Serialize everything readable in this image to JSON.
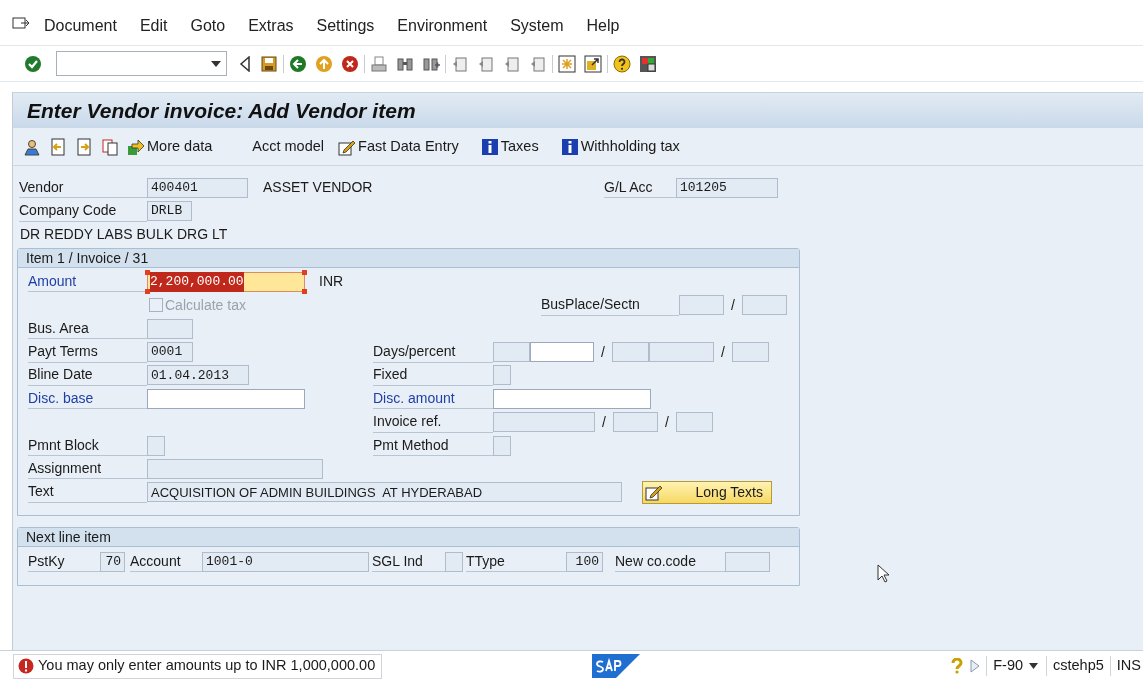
{
  "menu": [
    "Document",
    "Edit",
    "Goto",
    "Extras",
    "Settings",
    "Environment",
    "System",
    "Help"
  ],
  "title": "Enter Vendor invoice: Add Vendor item",
  "app_toolbar": [
    {
      "kind": "person"
    },
    {
      "kind": "doc-back"
    },
    {
      "kind": "doc-forward"
    },
    {
      "kind": "copy"
    },
    {
      "kind": "arrow",
      "label": "More data"
    },
    {
      "kind": "text",
      "label": "Acct model"
    },
    {
      "kind": "pencil",
      "label": "Fast Data Entry"
    },
    {
      "kind": "info",
      "label": "Taxes"
    },
    {
      "kind": "info",
      "label": "Withholding tax"
    }
  ],
  "header": {
    "vendor": {
      "label": "Vendor",
      "value": "400401",
      "description": "ASSET VENDOR"
    },
    "gl_account": {
      "label": "G/L Acc",
      "value": "101205"
    },
    "company_code": {
      "label": "Company Code",
      "value": "DRLB"
    },
    "company_name": "DR REDDY LABS BULK DRG LT"
  },
  "item": {
    "title": "Item 1 / Invoice / 31",
    "amount": {
      "label": "Amount",
      "highlighted": true,
      "value": "2,200,000.00",
      "error": true,
      "currency": "INR"
    },
    "calculate_tax": {
      "label": "Calculate tax",
      "checked": false,
      "disabled": true
    },
    "bus_place": {
      "label": "BusPlace/Sectn",
      "highlighted": false,
      "boxes": [
        {
          "editable": false
        },
        {
          "editable": false,
          "prefix": "/"
        }
      ]
    },
    "bus_area": {
      "label": "Bus. Area",
      "highlighted": false,
      "boxes": [
        {
          "editable": false
        }
      ]
    },
    "payt_terms": {
      "label": "Payt Terms",
      "highlighted": false,
      "boxes": [
        {
          "editable": false,
          "value": "0001"
        }
      ]
    },
    "days_percent": {
      "label": "Days/percent",
      "highlighted": false,
      "boxes": [
        {
          "editable": false
        },
        {
          "editable": true
        },
        {
          "editable": false,
          "prefix": "/"
        },
        {
          "editable": false
        },
        {
          "editable": false,
          "prefix": "/"
        }
      ]
    },
    "bline_date": {
      "label": "Bline Date",
      "highlighted": false,
      "boxes": [
        {
          "editable": false,
          "value": "01.04.2013"
        }
      ]
    },
    "fixed": {
      "label": "Fixed",
      "highlighted": false,
      "boxes": [
        {
          "editable": false
        }
      ]
    },
    "disc_base": {
      "label": "Disc. base",
      "highlighted": true,
      "boxes": [
        {
          "editable": true
        }
      ]
    },
    "disc_amount": {
      "label": "Disc. amount",
      "highlighted": true,
      "boxes": [
        {
          "editable": true
        }
      ]
    },
    "invoice_ref": {
      "label": "Invoice ref.",
      "highlighted": false,
      "boxes": [
        {
          "editable": false
        },
        {
          "editable": false,
          "prefix": "/"
        },
        {
          "editable": false,
          "prefix": "/"
        }
      ]
    },
    "pmnt_block": {
      "label": "Pmnt Block",
      "highlighted": false,
      "boxes": [
        {
          "editable": false
        }
      ]
    },
    "pmt_method": {
      "label": "Pmt Method",
      "highlighted": false,
      "boxes": [
        {
          "editable": false
        }
      ]
    },
    "assignment": {
      "label": "Assignment",
      "highlighted": false,
      "boxes": [
        {
          "editable": false
        }
      ]
    },
    "text": {
      "label": "Text",
      "highlighted": false,
      "boxes": [
        {
          "editable": false,
          "value": "ACQUISITION OF ADMIN BUILDINGS  AT HYDERABAD"
        }
      ]
    },
    "long_texts_button": "Long Texts"
  },
  "next_item": {
    "title": "Next line item",
    "fields": [
      {
        "label": "PstKy",
        "value": "70"
      },
      {
        "label": "Account",
        "value": "1001-0"
      },
      {
        "label": "SGL Ind"
      },
      {
        "label": "TType",
        "value": "100"
      },
      {
        "label": "New co.code"
      }
    ]
  },
  "status_bar": {
    "kind": "error",
    "message": "You may only enter amounts up to INR 1,000,000.00",
    "transaction": "F-90",
    "system": "cstehp5",
    "mode": "INS"
  }
}
